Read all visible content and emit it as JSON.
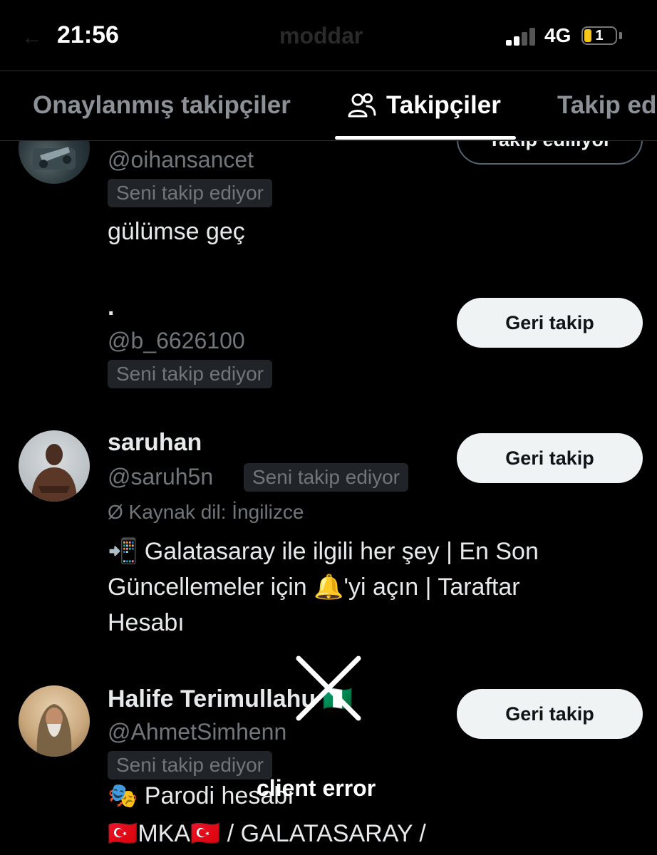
{
  "status_bar": {
    "time": "21:56",
    "ghost_title": "moddar",
    "network": "4G",
    "battery_level": "1",
    "battery_color": "#f5c518"
  },
  "tabs": [
    {
      "label": "Onaylanmış takipçiler",
      "active": false
    },
    {
      "label": "Takipçiler",
      "active": true,
      "icon": "people-icon"
    },
    {
      "label": "Takip ediliyor",
      "active": false
    }
  ],
  "followers": [
    {
      "handle": "@oihansancet",
      "badge": "Seni takip ediyor",
      "bio": "gülümse geç",
      "button": "Takip ediliyor"
    },
    {
      "name": ".",
      "handle": "@b_6626100",
      "badge": "Seni takip ediyor",
      "button": "Geri takip"
    },
    {
      "name": "saruhan",
      "handle": "@saruh5n",
      "badge": "Seni takip ediyor",
      "source_lang": "Ø Kaynak dil: İngilizce",
      "bio_lines": [
        "📲 Galatasaray ile ilgili her şey | En Son",
        "Güncellemeler için 🔔'yi açın | Taraftar",
        "Hesabı"
      ],
      "button": "Geri takip"
    },
    {
      "name": "Halife Terimullahu 🇳🇬",
      "handle": "@AhmetSimhenn",
      "badge": "Seni takip ediyor",
      "bio_lines": [
        "🎭 Parodi hesabı",
        "🇹🇷MKA🇹🇷 / GALATASARAY /"
      ],
      "button": "Geri takip"
    }
  ],
  "overlay": {
    "error_text": "client error",
    "icon": "close-icon"
  }
}
